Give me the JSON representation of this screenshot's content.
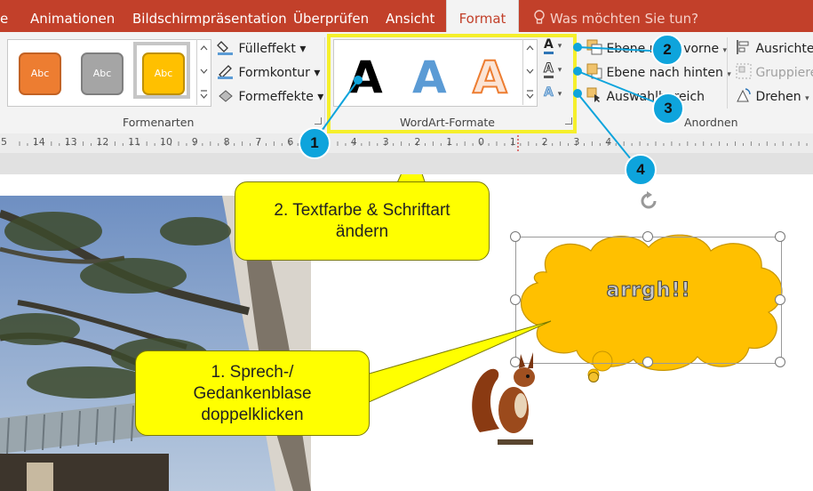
{
  "tabs": {
    "partial": "e",
    "animationen": "Animationen",
    "bildschirm": "Bildschirmpräsentation",
    "ueberpruefen": "Überprüfen",
    "ansicht": "Ansicht",
    "format": "Format",
    "tellme": "Was möchten Sie tun?"
  },
  "ribbon": {
    "shape_styles": {
      "label": "Formenarten",
      "swatch1": "Abc",
      "swatch2": "Abc",
      "swatch3": "Abc",
      "fill": "Fülleffekt",
      "outline": "Formkontur",
      "effects": "Formeffekte"
    },
    "wordart": {
      "label": "WordArt-Formate",
      "sample1": "A",
      "sample2": "A",
      "sample3": "A",
      "text_fill_icon": "A",
      "text_outline_icon": "A",
      "text_effects_icon": "A"
    },
    "arrange": {
      "label": "Anordnen",
      "bring_forward": "Ebene nach vorne",
      "send_backward": "Ebene nach hinten",
      "selection_pane": "Auswahlbereich",
      "align": "Ausrichten",
      "group": "Gruppieren",
      "rotate": "Drehen"
    }
  },
  "ruler": {
    "numbers": [
      "5",
      "14",
      "13",
      "12",
      "11",
      "10",
      "9",
      "8",
      "7",
      "6",
      "5",
      "4",
      "3",
      "2",
      "1",
      "0",
      "1",
      "2",
      "3",
      "4"
    ]
  },
  "slide": {
    "bubble_text": "arrgh!!"
  },
  "callouts": {
    "callout1": "1. Sprech-/\nGedankenblase\ndoppelklicken",
    "callout2": "2. Textfarbe & Schriftart\nändern"
  },
  "badges": [
    "1",
    "2",
    "3",
    "4"
  ],
  "colors": {
    "tab_bar": "#c2402a",
    "ribbon_bg": "#f3f3f3",
    "callout_yellow": "#ffff00",
    "badge_blue": "#0ea4dc",
    "bubble_fill": "#ffc000",
    "swatch_orange": "#ed7d31",
    "swatch_gray": "#a5a5a5",
    "swatch_gold": "#ffc000"
  }
}
